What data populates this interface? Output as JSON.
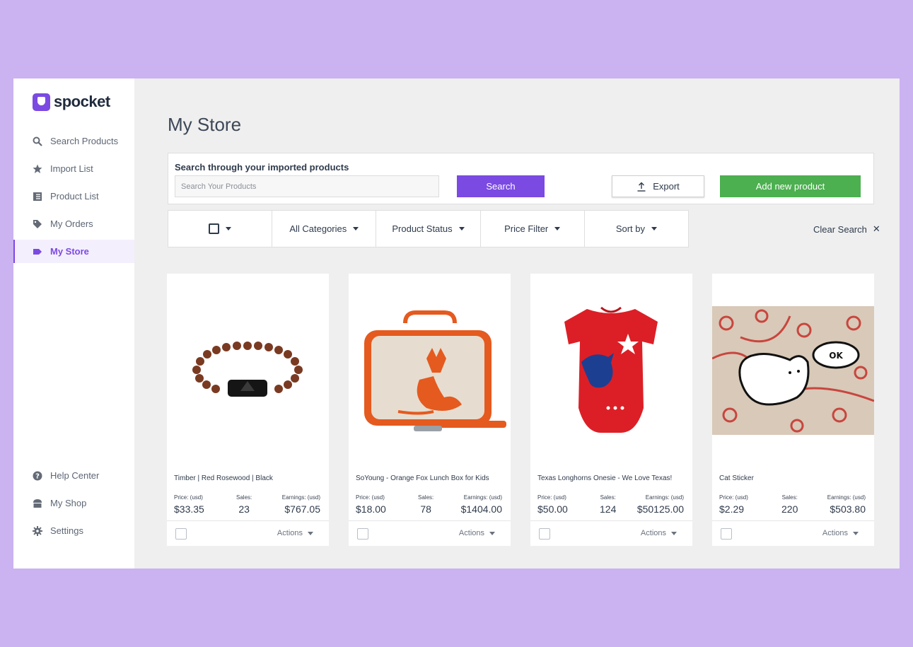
{
  "brand": {
    "name": "spocket",
    "color": "#7b4ae2"
  },
  "sidebar": {
    "top_items": [
      {
        "label": "Search Products",
        "icon": "search-icon"
      },
      {
        "label": "Import List",
        "icon": "star-icon"
      },
      {
        "label": "Product List",
        "icon": "list-icon"
      },
      {
        "label": "My Orders",
        "icon": "tag-icon"
      },
      {
        "label": "My Store",
        "icon": "label-icon",
        "active": true
      }
    ],
    "bottom_items": [
      {
        "label": "Help Center",
        "icon": "help-icon"
      },
      {
        "label": "My Shop",
        "icon": "shop-icon"
      },
      {
        "label": "Settings",
        "icon": "gear-icon"
      }
    ]
  },
  "page": {
    "title": "My Store"
  },
  "search": {
    "label": "Search through your imported products",
    "placeholder": "Search Your Products",
    "search_button": "Search",
    "export_button": "Export",
    "add_button": "Add new product"
  },
  "filters": {
    "categories": "All Categories",
    "status": "Product Status",
    "price": "Price Filter",
    "sort": "Sort by",
    "clear": "Clear Search"
  },
  "card_labels": {
    "price": "Price: (usd)",
    "sales": "Sales:",
    "earnings": "Earnings: (usd)",
    "actions": "Actions"
  },
  "products": [
    {
      "name": "Timber | Red Rosewood | Black",
      "price": "$33.35",
      "sales": "23",
      "earnings": "$767.05",
      "image": "bracelet"
    },
    {
      "name": "SoYoung - Orange Fox Lunch Box for Kids",
      "price": "$18.00",
      "sales": "78",
      "earnings": "$1404.00",
      "image": "lunchbox"
    },
    {
      "name": "Texas Longhorns Onesie - We Love Texas!",
      "price": "$50.00",
      "sales": "124",
      "earnings": "$50125.00",
      "image": "onesie"
    },
    {
      "name": "Cat Sticker",
      "price": "$2.29",
      "sales": "220",
      "earnings": "$503.80",
      "image": "cat-sticker"
    }
  ],
  "colors": {
    "accent": "#7b4ae2",
    "add_green": "#4caf50",
    "background": "#cbb2f0"
  }
}
